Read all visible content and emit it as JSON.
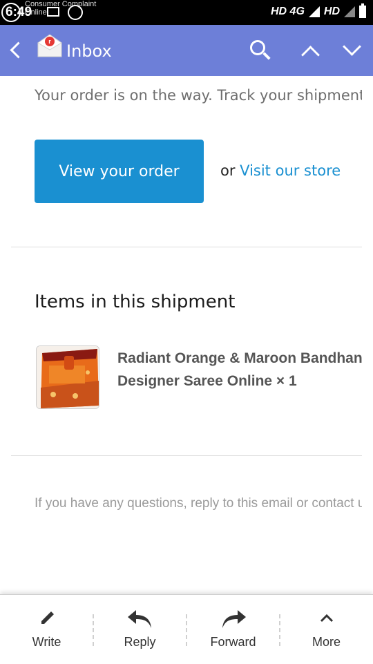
{
  "status_bar": {
    "clock": "6:49",
    "notification_text": "Consumer Complaint\nOnline",
    "network_1": "HD 4G",
    "network_2": "HD"
  },
  "app_bar": {
    "title": "Inbox"
  },
  "email": {
    "intro_text": "Your order is on the way. Track your shipment",
    "view_order_button": "View your order",
    "or_text": "or",
    "visit_store_link": "Visit our store",
    "items_heading": "Items in this shipment",
    "product_line1": "Radiant Orange & Maroon Bandhani",
    "product_line2": "Designer Saree Online × 1",
    "footer_text": "If you have any questions, reply to this email or contact us"
  },
  "bottom_bar": {
    "items": [
      {
        "label": "Write",
        "icon": "pencil-icon"
      },
      {
        "label": "Reply",
        "icon": "reply-icon"
      },
      {
        "label": "Forward",
        "icon": "forward-icon"
      },
      {
        "label": "More",
        "icon": "chevron-up-icon"
      }
    ]
  },
  "colors": {
    "app_bar": "#6d7fd8",
    "button": "#1a90d1",
    "link": "#1a90d1"
  }
}
